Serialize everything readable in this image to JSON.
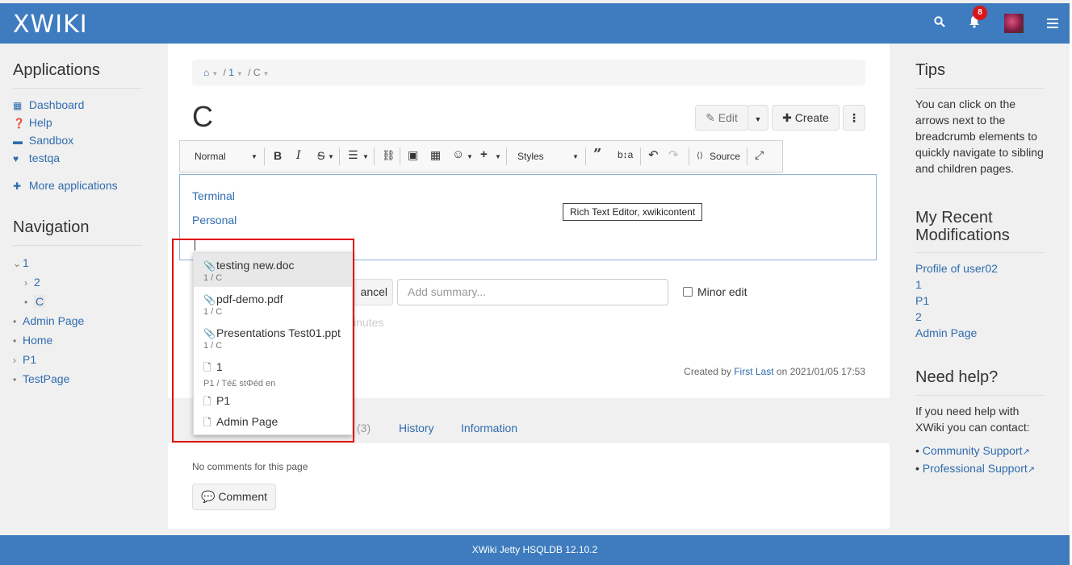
{
  "app": {
    "logo_text": "XWIKI",
    "notification_count": "8"
  },
  "colors": {
    "brand": "#3e7cbf",
    "link": "#2f6cae",
    "highlight_box": "#e00000"
  },
  "icons": {
    "search": "search-icon",
    "bell": "bell-icon",
    "menu": "hamburger-icon"
  },
  "left_sidebar": {
    "applications_title": "Applications",
    "applications": [
      {
        "label": "Dashboard",
        "icon": "dashboard-icon"
      },
      {
        "label": "Help",
        "icon": "help-icon"
      },
      {
        "label": "Sandbox",
        "icon": "sandbox-icon"
      },
      {
        "label": "testqa",
        "icon": "heart-icon"
      }
    ],
    "more_applications": "More applications",
    "navigation_title": "Navigation",
    "tree": [
      {
        "label": "1",
        "caret": "expanded"
      },
      {
        "label": "2",
        "caret": "collapsed"
      },
      {
        "label": "C",
        "caret": "bullet",
        "selected": true
      },
      {
        "label": "Admin Page",
        "caret": "bullet"
      },
      {
        "label": "Home",
        "caret": "bullet"
      },
      {
        "label": "P1",
        "caret": "collapsed"
      },
      {
        "label": "TestPage",
        "caret": "bullet"
      }
    ]
  },
  "breadcrumb": [
    "1",
    "C"
  ],
  "page": {
    "title": "C",
    "edit_label": "Edit",
    "create_label": "Create"
  },
  "toolbar": {
    "format": "Normal",
    "styles": "Styles",
    "source": "Source"
  },
  "editor": {
    "lines": [
      "Terminal",
      "Personal"
    ],
    "tooltip": "Rich Text Editor, xwikicontent"
  },
  "autocomplete": {
    "items": [
      {
        "name": "testing new.doc",
        "hint": "1 / C",
        "type": "attachment"
      },
      {
        "name": "pdf-demo.pdf",
        "hint": "1 / C",
        "type": "attachment"
      },
      {
        "name": "Presentations Test01.ppt",
        "hint": "1 / C",
        "type": "attachment"
      },
      {
        "name": "1",
        "hint": "P1 / Té£ stΦéd en",
        "type": "page"
      },
      {
        "name": "P1",
        "hint": "",
        "type": "page"
      },
      {
        "name": "Admin Page",
        "hint": "",
        "type": "page"
      }
    ]
  },
  "edit_form": {
    "cancel_fragment": "ancel",
    "summary_placeholder": "Add summary...",
    "minor_edit": "Minor edit",
    "minutes_fragment": "inutes"
  },
  "created": {
    "prefix": "Created by",
    "author": "First Last",
    "suffix": "on 2021/01/05 17:53"
  },
  "tabs": {
    "count_fragment": "(3)",
    "history": "History",
    "information": "Information"
  },
  "comments": {
    "none": "No comments for this page",
    "button": "Comment"
  },
  "right_sidebar": {
    "tips_title": "Tips",
    "tips_text": "You can click on the arrows next to the breadcrumb elements to quickly navigate to sibling and children pages.",
    "recent_title": "My Recent Modifications",
    "recent": [
      "Profile of user02",
      "1",
      "P1",
      "2",
      "Admin Page"
    ],
    "help_title": "Need help?",
    "help_text": "If you need help with XWiki you can contact:",
    "help_links": [
      "Community Support",
      "Professional Support"
    ]
  },
  "footer": {
    "text": "XWiki Jetty HSQLDB 12.10.2"
  }
}
